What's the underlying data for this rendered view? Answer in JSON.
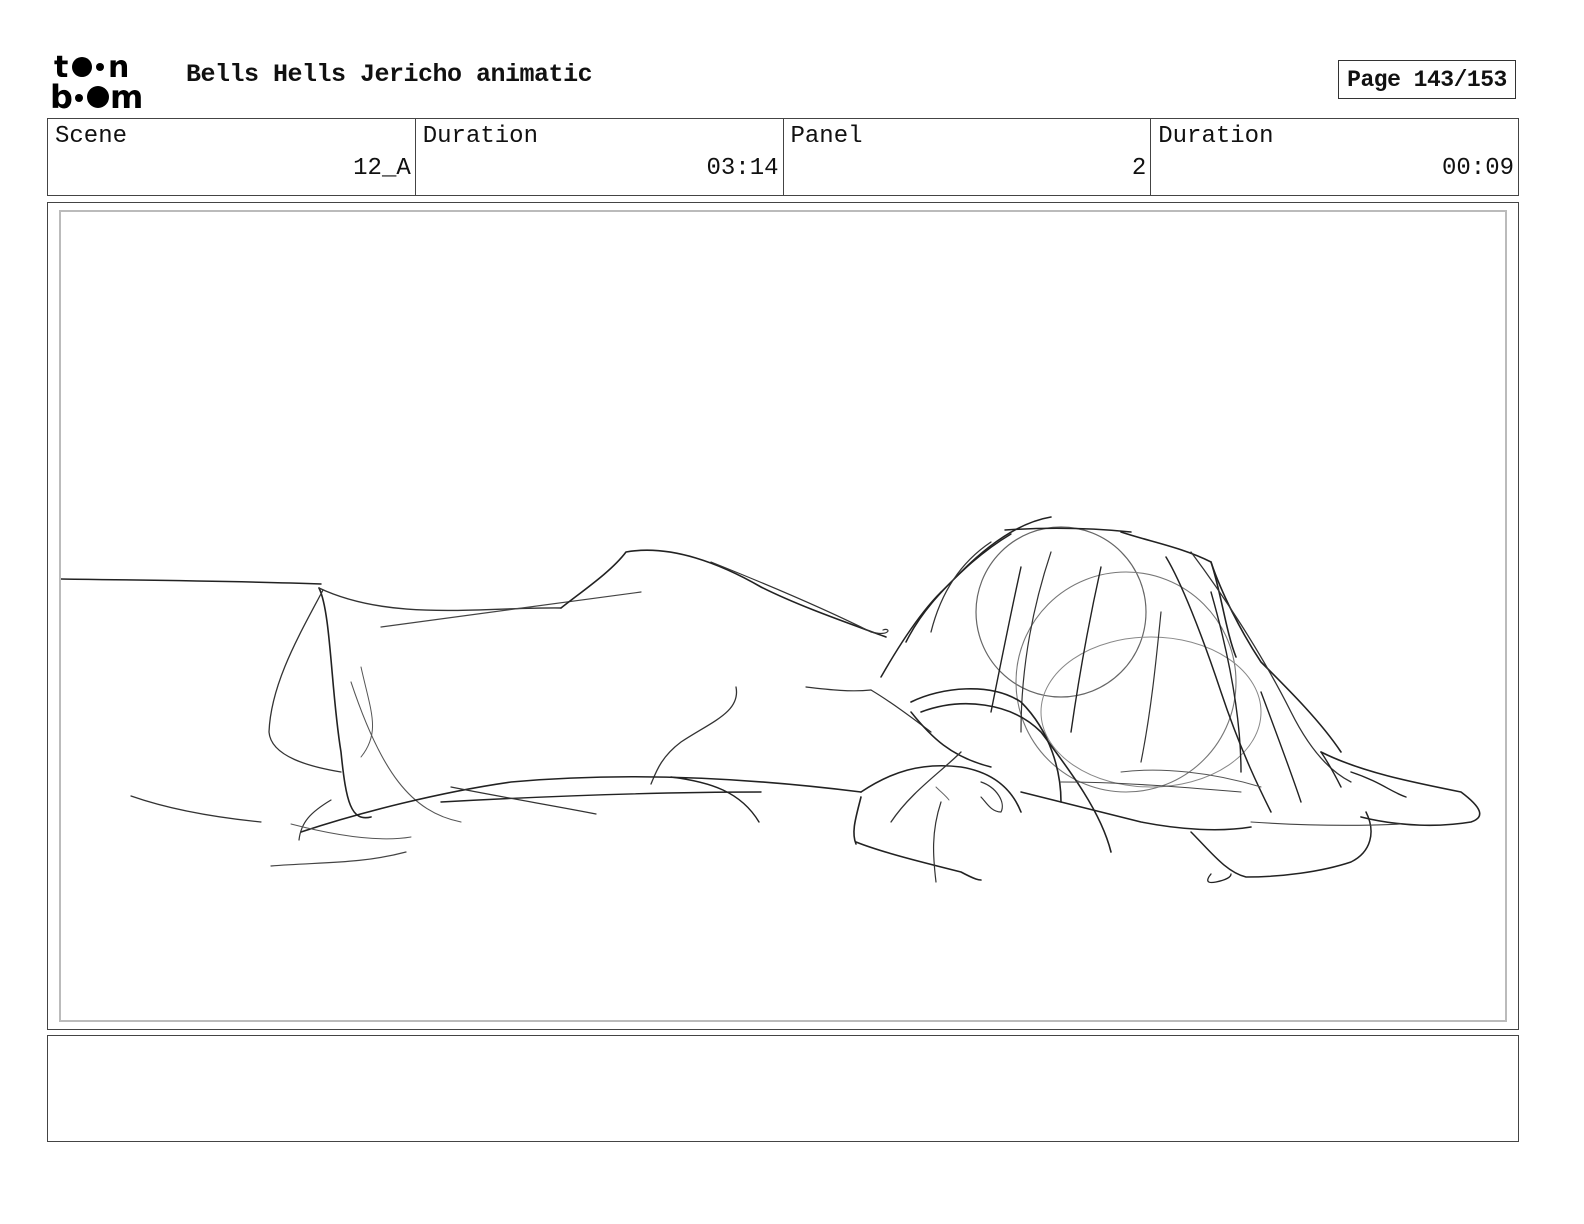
{
  "header": {
    "logo": {
      "brand": "toon boom",
      "icon": "toon-boom-logo"
    },
    "title": "Bells Hells Jericho animatic",
    "page": "Page 143/153"
  },
  "info_bar": [
    {
      "label": "Scene",
      "value": "12_A"
    },
    {
      "label": "Duration",
      "value": "03:14"
    },
    {
      "label": "Panel",
      "value": "2"
    },
    {
      "label": "Duration",
      "value": "00:09"
    }
  ],
  "panel": {
    "image": "rough-sketch-figure-lying-down"
  },
  "notes": {
    "text": ""
  }
}
